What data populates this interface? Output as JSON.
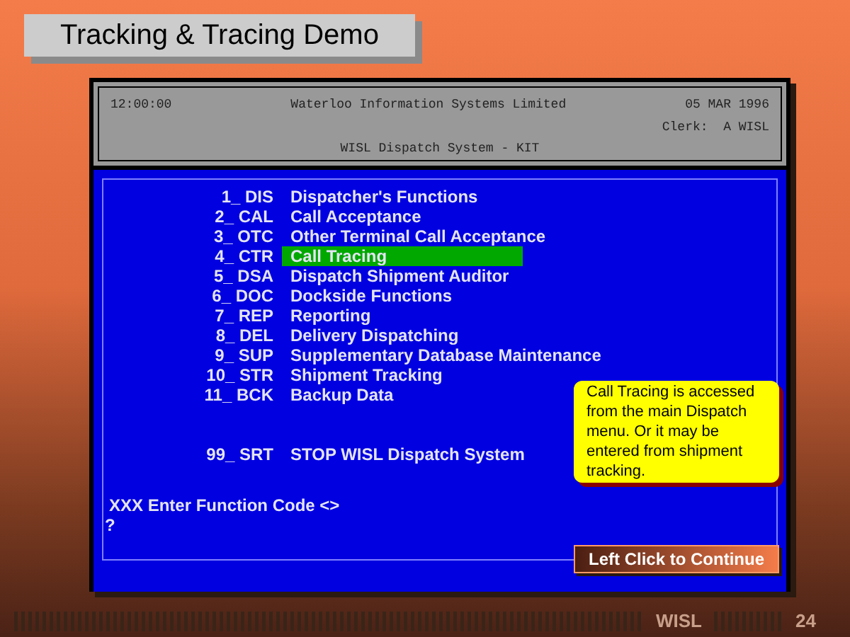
{
  "title": "Tracking & Tracing Demo",
  "header": {
    "time": "12:00:00",
    "company": "Waterloo Information Systems Limited",
    "date": "05 MAR 1996",
    "clerk": "Clerk:  A WISL",
    "system": "WISL Dispatch System - KIT"
  },
  "menu": [
    {
      "code": "1_ DIS",
      "label": "Dispatcher's Functions",
      "selected": false
    },
    {
      "code": "2_ CAL",
      "label": "Call Acceptance",
      "selected": false
    },
    {
      "code": "3_ OTC",
      "label": "Other Terminal Call Acceptance",
      "selected": false
    },
    {
      "code": "4_ CTR",
      "label": "Call Tracing",
      "selected": true
    },
    {
      "code": "5_ DSA",
      "label": "Dispatch Shipment Auditor",
      "selected": false
    },
    {
      "code": "6_ DOC",
      "label": "Dockside Functions",
      "selected": false
    },
    {
      "code": "7_ REP",
      "label": "Reporting",
      "selected": false
    },
    {
      "code": "8_ DEL",
      "label": "Delivery Dispatching",
      "selected": false
    },
    {
      "code": "9_ SUP",
      "label": "Supplementary Database Maintenance",
      "selected": false
    },
    {
      "code": "10_ STR",
      "label": "Shipment Tracking",
      "selected": false
    },
    {
      "code": "11_ BCK",
      "label": "Backup Data",
      "selected": false
    }
  ],
  "stop_item": {
    "code": "99_ SRT",
    "label": "STOP WISL Dispatch System"
  },
  "prompt": "XXX Enter Function Code <>",
  "cursor": "?",
  "callout": "Call Tracing is accessed from the main Dispatch menu. Or it may be entered from shipment tracking.",
  "continue_button": "Left Click to Continue",
  "footer": {
    "brand": "WISL",
    "page": "24"
  }
}
